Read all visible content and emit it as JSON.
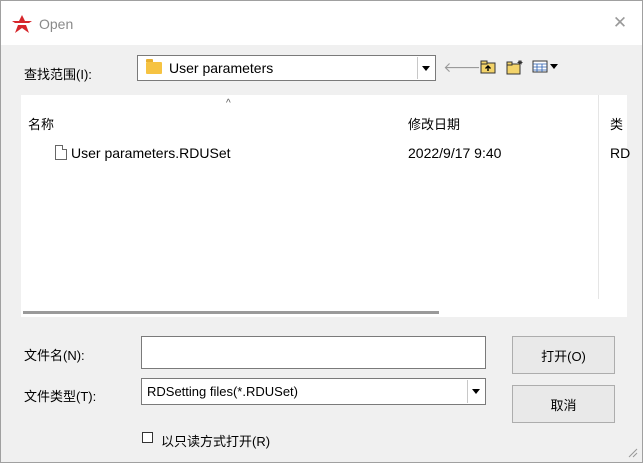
{
  "window": {
    "title": "Open",
    "close_glyph": "✕"
  },
  "lookin": {
    "label": "查找范围(I):",
    "value": "User parameters"
  },
  "toolbar": {
    "icons": [
      "back-arrow-icon",
      "up-folder-icon",
      "new-folder-icon",
      "view-menu-icon"
    ],
    "back_glyph": "🡐"
  },
  "list": {
    "sort_indicator": "^",
    "columns": [
      "名称",
      "修改日期",
      "类"
    ],
    "rows": [
      {
        "name": "User parameters.RDUSet",
        "modified": "2022/9/17 9:40",
        "type": "RD"
      }
    ]
  },
  "filename": {
    "label": "文件名(N):",
    "value": ""
  },
  "filetype": {
    "label": "文件类型(T):",
    "value": "RDSetting files(*.RDUSet)"
  },
  "buttons": {
    "open": "打开(O)",
    "cancel": "取消"
  },
  "readonly": {
    "label": "以只读方式打开(R)",
    "checked": false
  }
}
